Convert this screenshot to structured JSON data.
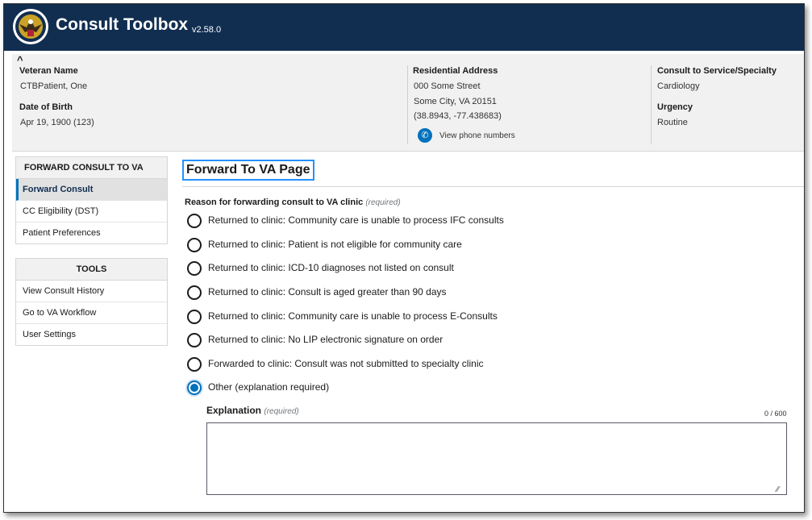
{
  "header": {
    "app_title": "Consult Toolbox",
    "version": "v2.58.0",
    "bg_color": "#112e51"
  },
  "banner": {
    "collapse_icon": "chevron-up-icon",
    "veteran_name_label": "Veteran Name",
    "veteran_name": "CTBPatient, One",
    "dob_label": "Date of Birth",
    "dob": "Apr 19, 1900 (123)",
    "address_label": "Residential Address",
    "address_line1": "000 Some Street",
    "address_line2": "Some City, VA 20151",
    "address_coords": "(38.8943, -77.438683)",
    "phone_link": "View phone numbers",
    "service_label": "Consult to Service/Specialty",
    "service": "Cardiology",
    "urgency_label": "Urgency",
    "urgency": "Routine"
  },
  "sidebar": {
    "forward_section": {
      "heading": "FORWARD CONSULT TO VA",
      "items": [
        {
          "label": "Forward Consult",
          "active": true
        },
        {
          "label": "CC Eligibility (DST)",
          "active": false
        },
        {
          "label": "Patient Preferences",
          "active": false
        }
      ]
    },
    "tools_section": {
      "heading": "TOOLS",
      "items": [
        {
          "label": "View Consult History"
        },
        {
          "label": "Go to VA Workflow"
        },
        {
          "label": "User Settings"
        }
      ]
    }
  },
  "main": {
    "page_title": "Forward To VA Page",
    "reason_legend": "Reason for forwarding consult to VA clinic",
    "required_text": "(required)",
    "options": [
      {
        "label": "Returned to clinic: Community care is unable to process IFC consults",
        "checked": false
      },
      {
        "label": "Returned to clinic: Patient is not eligible for community care",
        "checked": false
      },
      {
        "label": "Returned to clinic: ICD-10 diagnoses not listed on consult",
        "checked": false
      },
      {
        "label": "Returned to clinic: Consult is aged greater than 90 days",
        "checked": false
      },
      {
        "label": "Returned to clinic: Community care is unable to process E-Consults",
        "checked": false
      },
      {
        "label": "Returned to clinic: No LIP electronic signature on order",
        "checked": false
      },
      {
        "label": "Forwarded to clinic: Consult was not submitted to specialty clinic",
        "checked": false
      },
      {
        "label": "Other (explanation required)",
        "checked": true
      }
    ],
    "explanation_label": "Explanation",
    "explanation_required": "(required)",
    "char_count": "0 / 600",
    "explanation_value": ""
  },
  "colors": {
    "accent": "#0071bb",
    "focus": "#2491ff",
    "banner_bg": "#f1f1f1"
  }
}
